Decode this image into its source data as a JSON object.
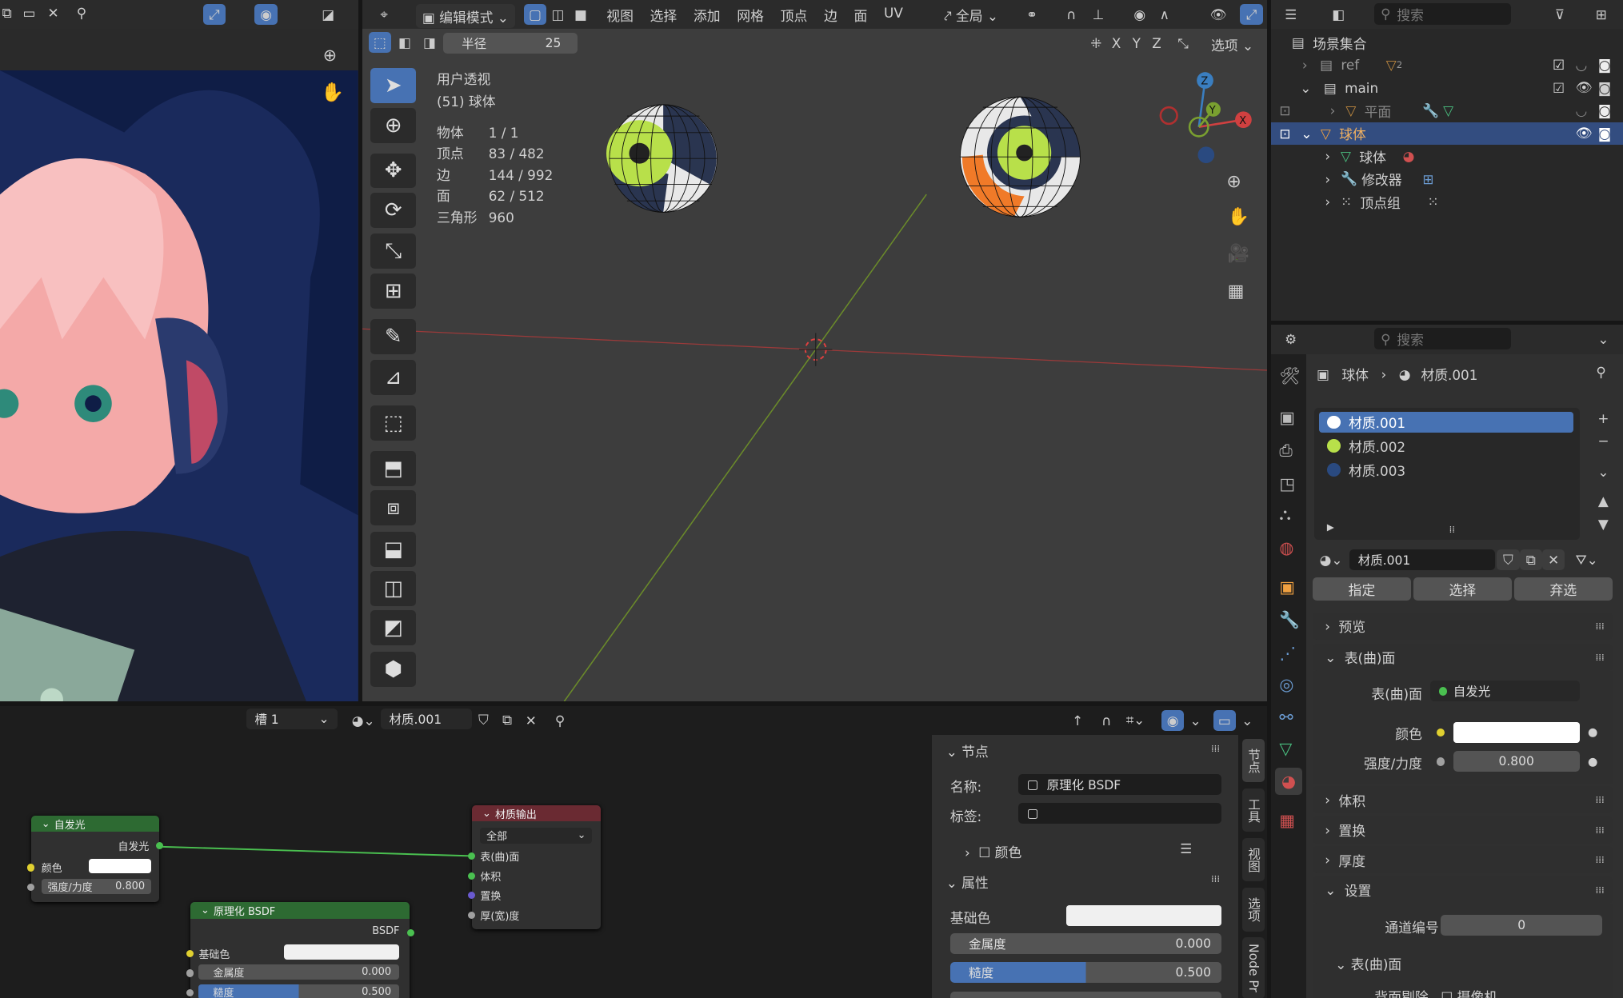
{
  "top_left_header": {
    "icons": [
      "duplicate-icon",
      "folder-icon",
      "close-icon",
      "pin-icon"
    ]
  },
  "viewport": {
    "mode": "编辑模式",
    "menus": [
      "视图",
      "选择",
      "添加",
      "网格",
      "顶点",
      "边",
      "面",
      "UV"
    ],
    "transform_orientation": "全局",
    "options_label": "选项",
    "axes": [
      "X",
      "Y",
      "Z"
    ],
    "radius_label": "半径",
    "radius_value": "25",
    "view_name": "用户透视",
    "object_name": "(51) 球体",
    "stats": [
      {
        "label": "物体",
        "value": "1 / 1"
      },
      {
        "label": "顶点",
        "value": "83 / 482"
      },
      {
        "label": "边",
        "value": "144 / 992"
      },
      {
        "label": "面",
        "value": "62 / 512"
      },
      {
        "label": "三角形",
        "value": "960"
      }
    ],
    "gizmo": {
      "z": "Z",
      "y": "Y",
      "x": "X"
    }
  },
  "outliner": {
    "search_placeholder": "搜索",
    "collection": "场景集合",
    "items": [
      {
        "name": "ref",
        "badge": "2"
      },
      {
        "name": "main"
      },
      {
        "name": "平面"
      },
      {
        "name": "球体"
      },
      {
        "name": "球体"
      },
      {
        "name": "修改器"
      },
      {
        "name": "顶点组"
      }
    ]
  },
  "properties": {
    "search_placeholder": "搜索",
    "breadcrumb": {
      "object": "球体",
      "material": "材质.001"
    },
    "slots": [
      {
        "name": "材质.001",
        "color": "#ffffff"
      },
      {
        "name": "材质.002",
        "color": "#b8e04a"
      },
      {
        "name": "材质.003",
        "color": "#2a4a80"
      }
    ],
    "material_name": "材质.001",
    "buttons": {
      "assign": "指定",
      "select": "选择",
      "deselect": "弃选"
    },
    "sections": {
      "preview": "预览",
      "surface": "表(曲)面",
      "volume": "体积",
      "displace": "置换",
      "thickness": "厚度",
      "settings": "设置",
      "surface_sub": "表(曲)面"
    },
    "surface_label": "表(曲)面",
    "surface_value": "自发光",
    "color_label": "颜色",
    "strength_label": "强度/力度",
    "strength_value": "0.800",
    "pass_index_label": "通道编号",
    "pass_index_value": "0",
    "backface_label": "背面剔除",
    "camera_label": "摄像机"
  },
  "node_editor": {
    "slot": "槽 1",
    "material": "材质.001",
    "emission_node": {
      "title": "自发光",
      "out": "自发光",
      "color": "颜色",
      "strength_label": "强度/力度",
      "strength": "0.800"
    },
    "output_node": {
      "title": "材质输出",
      "target": "全部",
      "inputs": [
        "表(曲)面",
        "体积",
        "置换",
        "厚(宽)度"
      ]
    },
    "bsdf_node": {
      "title": "原理化 BSDF",
      "out": "BSDF",
      "base": "基础色",
      "metal_label": "金属度",
      "metal": "0.000",
      "rough_label": "糙度",
      "rough": "0.500"
    }
  },
  "sidebar": {
    "node_section": "节点",
    "name_label": "名称:",
    "name_value": "原理化 BSDF",
    "label_label": "标签:",
    "color_label": "颜色",
    "props_section": "属性",
    "base_color": "基础色",
    "metal_label": "金属度",
    "metal": "0.000",
    "rough_label": "糙度",
    "rough": "0.500",
    "rough_fraction": 0.5,
    "tabs": [
      "节点",
      "工具",
      "视图",
      "选项",
      "Node Pr"
    ]
  }
}
